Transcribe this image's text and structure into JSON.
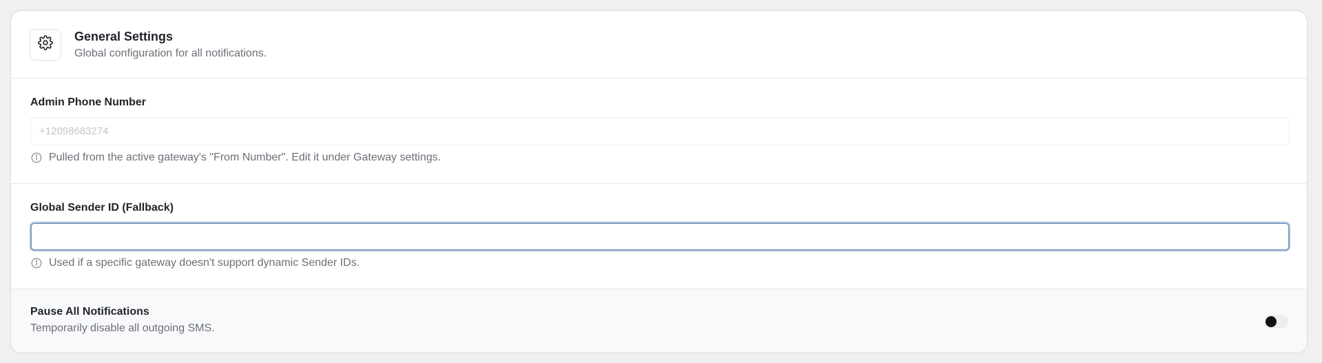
{
  "header": {
    "icon": "gear-icon",
    "title": "General Settings",
    "subtitle": "Global configuration for all notifications."
  },
  "admin_phone": {
    "label": "Admin Phone Number",
    "placeholder": "+12098683274",
    "value": "",
    "hint_icon": "info-icon",
    "hint": "Pulled from the active gateway's \"From Number\". Edit it under Gateway settings."
  },
  "sender_id": {
    "label": "Global Sender ID (Fallback)",
    "placeholder": "",
    "value": "",
    "focused": true,
    "hint_icon": "info-icon",
    "hint": "Used if a specific gateway doesn't support dynamic Sender IDs."
  },
  "pause": {
    "title": "Pause All Notifications",
    "description": "Temporarily disable all outgoing SMS.",
    "toggle_on": false
  },
  "colors": {
    "focus_border": "#7d98c0",
    "muted_text": "#6b6f76",
    "background": "#f0f0f0"
  }
}
